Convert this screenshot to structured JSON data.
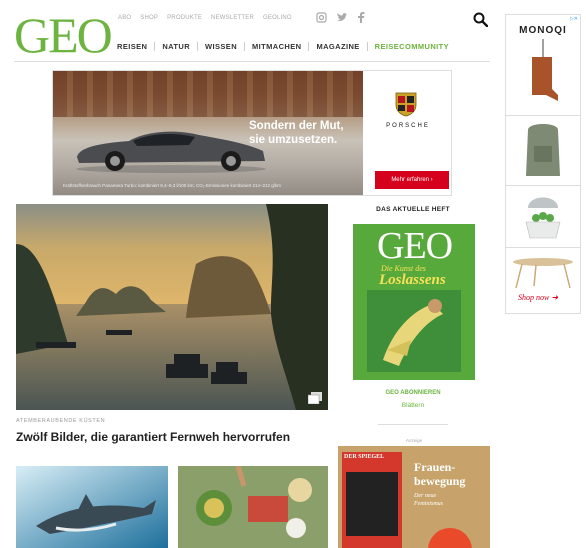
{
  "header": {
    "logo": "GEO",
    "top_links": [
      "ABO",
      "SHOP",
      "PRODUKTE",
      "NEWSLETTER",
      "GEOLINO"
    ],
    "social_icons": [
      "instagram-icon",
      "twitter-icon",
      "facebook-icon"
    ],
    "nav": [
      "REISEN",
      "NATUR",
      "WISSEN",
      "MITMACHEN",
      "MAGAZINE",
      "REISECOMMUNITY"
    ],
    "search_icon": "search-icon"
  },
  "ad_porsche": {
    "headline_line1": "Sondern der Mut,",
    "headline_line2": "sie umzusetzen.",
    "smallprint": "Kraftstoffverbrauch Panamera Turbo: kombiniert 9,4–9,3 l/100 km; CO₂-Emissionen kombiniert 214–212 g/km",
    "brand": "PORSCHE",
    "cta": "Mehr erfahren  ›",
    "accent": "#d5001c"
  },
  "hero": {
    "kicker": "ATEMBERAUBENDE KÜSTEN",
    "title": "Zwölf Bilder, die garantiert Fernweh hervorrufen",
    "gallery_icon": "gallery-icon"
  },
  "issue": {
    "heading": "DAS AKTUELLE HEFT",
    "cover_logo": "GEO",
    "cover_title_small": "Die Kunst des",
    "cover_title_big": "Loslassens",
    "subscribe": "GEO ABONNIEREN",
    "browse": "Blättern"
  },
  "ad_spiegel": {
    "label": "Anzeige",
    "cover_brand": "DER SPIEGEL",
    "headline_line1": "Frauen-",
    "headline_line2": "bewegung",
    "sub_line1": "Der neue",
    "sub_line2": "Feminismus"
  },
  "sidebar_ad": {
    "adchoices": "▷✕",
    "brand": "MONOQI",
    "cta": "Shop now ➜"
  },
  "colors": {
    "brand_green": "#6cb33f",
    "text": "#222222"
  }
}
